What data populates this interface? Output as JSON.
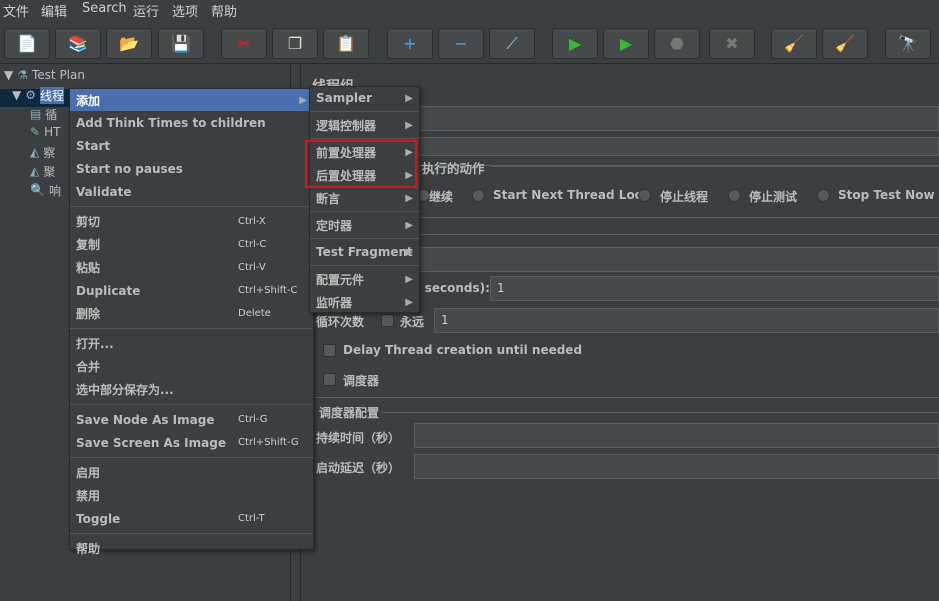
{
  "menubar": [
    "文件",
    "编辑",
    "Search",
    "运行",
    "选项",
    "帮助"
  ],
  "toolbar": [
    {
      "icon": "new-icon",
      "glyph": "📄"
    },
    {
      "icon": "templates-icon",
      "glyph": "📚"
    },
    {
      "icon": "open-icon",
      "glyph": "📂"
    },
    {
      "icon": "save-icon",
      "glyph": "💾"
    },
    {
      "icon": "cut-icon",
      "glyph": "✂"
    },
    {
      "icon": "copy-icon",
      "glyph": "❐"
    },
    {
      "icon": "paste-icon",
      "glyph": "📋"
    },
    {
      "icon": "expand-icon",
      "glyph": "+"
    },
    {
      "icon": "collapse-icon",
      "glyph": "−"
    },
    {
      "icon": "toggle-icon",
      "glyph": "⟋"
    },
    {
      "icon": "start-icon",
      "glyph": "▶"
    },
    {
      "icon": "start-no-pauses-icon",
      "glyph": "▶"
    },
    {
      "icon": "stop-icon",
      "glyph": "⬣"
    },
    {
      "icon": "shutdown-icon",
      "glyph": "✖"
    },
    {
      "icon": "clear-icon",
      "glyph": "🧹"
    },
    {
      "icon": "clear-all-icon",
      "glyph": "🧹"
    },
    {
      "icon": "search-icon",
      "glyph": "🔭"
    }
  ],
  "tree": [
    {
      "label": "Test Plan",
      "icon": "test-plan-icon",
      "glyph": "⚗"
    },
    {
      "label": "线程",
      "icon": "thread-group-icon",
      "glyph": "⚙"
    },
    {
      "label": "循",
      "icon": "controller-icon",
      "glyph": "▤"
    },
    {
      "label": "HT",
      "icon": "sampler-icon",
      "glyph": "✎"
    },
    {
      "label": "察",
      "icon": "listener-icon",
      "glyph": "◭"
    },
    {
      "label": "聚",
      "icon": "listener-icon",
      "glyph": "◭"
    },
    {
      "label": "响",
      "icon": "magnifier-icon",
      "glyph": "🔍"
    }
  ],
  "panel": {
    "title": "线程组",
    "error_action_label": "执行的动作",
    "radios": [
      "继续",
      "Start Next Thread Loop",
      "停止线程",
      "停止测试",
      "Stop Test Now"
    ],
    "rampup_label": "n seconds):",
    "rampup_value": "1",
    "loop_label": "循环次数",
    "forever_label": "永远",
    "loop_value": "1",
    "delay_label": "Delay Thread creation until needed",
    "scheduler_label": "调度器",
    "scheduler_config": "调度器配置",
    "duration_label": "持续时间（秒）",
    "startup_delay_label": "启动延迟（秒）"
  },
  "context_menu": [
    {
      "label": "添加",
      "submenu": true,
      "selected": true
    },
    {
      "label": "Add Think Times to children"
    },
    {
      "label": "Start"
    },
    {
      "label": "Start no pauses"
    },
    {
      "label": "Validate"
    },
    {
      "sep": true
    },
    {
      "label": "剪切",
      "shortcut": "Ctrl-X"
    },
    {
      "label": "复制",
      "shortcut": "Ctrl-C"
    },
    {
      "label": "粘贴",
      "shortcut": "Ctrl-V"
    },
    {
      "label": "Duplicate",
      "shortcut": "Ctrl+Shift-C"
    },
    {
      "label": "删除",
      "shortcut": "Delete"
    },
    {
      "sep": true
    },
    {
      "label": "打开..."
    },
    {
      "label": "合并"
    },
    {
      "label": "选中部分保存为..."
    },
    {
      "sep": true
    },
    {
      "label": "Save Node As Image",
      "shortcut": "Ctrl-G"
    },
    {
      "label": "Save Screen As Image",
      "shortcut": "Ctrl+Shift-G"
    },
    {
      "sep": true
    },
    {
      "label": "启用"
    },
    {
      "label": "禁用"
    },
    {
      "label": "Toggle",
      "shortcut": "Ctrl-T"
    },
    {
      "sep": true
    },
    {
      "label": "帮助"
    }
  ],
  "submenu": [
    "Sampler",
    "逻辑控制器",
    "前置处理器",
    "后置处理器",
    "断言",
    "定时器",
    "Test Fragment",
    "配置元件",
    "监听器"
  ],
  "colors": {
    "background": "#3c3f41",
    "selection": "#4b6eaf",
    "highlight_box": "#d0171b"
  }
}
